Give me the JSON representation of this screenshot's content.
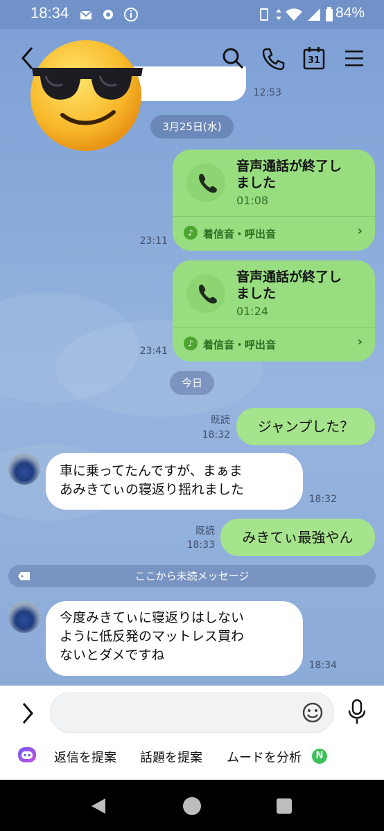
{
  "status_bar": {
    "time": "18:34",
    "battery": "84%"
  },
  "header": {
    "calendar_day": "31"
  },
  "messages": {
    "partial_top_time": "12:53",
    "date_divider_1": "3月25日(水)",
    "call1": {
      "title": "音声通話が終了しました",
      "duration": "01:08",
      "ringtone": "着信音・呼出音",
      "time": "23:11"
    },
    "call2": {
      "title": "音声通話が終了しました",
      "duration": "01:24",
      "ringtone": "着信音・呼出音",
      "time": "23:41"
    },
    "date_divider_2": "今日",
    "sent1": {
      "text": "ジャンプした？",
      "read": "既読",
      "time": "18:32"
    },
    "recv1": {
      "line1": "車に乗ってたんですが、まぁま",
      "line2": "あみきてぃの寝返り揺れました",
      "time": "18:32"
    },
    "sent2": {
      "text": "みきてぃ最強やん",
      "read": "既読",
      "time": "18:33"
    },
    "unread_divider": "ここから未読メッセージ",
    "recv2": {
      "line1": "今度みきてぃに寝返りはしない",
      "line2": "ように低反発のマットレス買わ",
      "line3": "ないとダメですね",
      "time": "18:34"
    }
  },
  "input": {
    "placeholder": ""
  },
  "suggestions": {
    "reply": "返信を提案",
    "topic": "話題を提案",
    "mood": "ムードを分析",
    "badge": "N"
  }
}
